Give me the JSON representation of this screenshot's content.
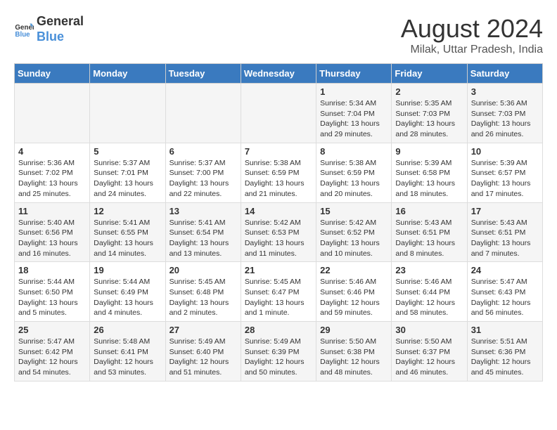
{
  "header": {
    "logo_line1": "General",
    "logo_line2": "Blue",
    "main_title": "August 2024",
    "subtitle": "Milak, Uttar Pradesh, India"
  },
  "days_of_week": [
    "Sunday",
    "Monday",
    "Tuesday",
    "Wednesday",
    "Thursday",
    "Friday",
    "Saturday"
  ],
  "weeks": [
    [
      {
        "day": "",
        "info": ""
      },
      {
        "day": "",
        "info": ""
      },
      {
        "day": "",
        "info": ""
      },
      {
        "day": "",
        "info": ""
      },
      {
        "day": "1",
        "info": "Sunrise: 5:34 AM\nSunset: 7:04 PM\nDaylight: 13 hours\nand 29 minutes."
      },
      {
        "day": "2",
        "info": "Sunrise: 5:35 AM\nSunset: 7:03 PM\nDaylight: 13 hours\nand 28 minutes."
      },
      {
        "day": "3",
        "info": "Sunrise: 5:36 AM\nSunset: 7:03 PM\nDaylight: 13 hours\nand 26 minutes."
      }
    ],
    [
      {
        "day": "4",
        "info": "Sunrise: 5:36 AM\nSunset: 7:02 PM\nDaylight: 13 hours\nand 25 minutes."
      },
      {
        "day": "5",
        "info": "Sunrise: 5:37 AM\nSunset: 7:01 PM\nDaylight: 13 hours\nand 24 minutes."
      },
      {
        "day": "6",
        "info": "Sunrise: 5:37 AM\nSunset: 7:00 PM\nDaylight: 13 hours\nand 22 minutes."
      },
      {
        "day": "7",
        "info": "Sunrise: 5:38 AM\nSunset: 6:59 PM\nDaylight: 13 hours\nand 21 minutes."
      },
      {
        "day": "8",
        "info": "Sunrise: 5:38 AM\nSunset: 6:59 PM\nDaylight: 13 hours\nand 20 minutes."
      },
      {
        "day": "9",
        "info": "Sunrise: 5:39 AM\nSunset: 6:58 PM\nDaylight: 13 hours\nand 18 minutes."
      },
      {
        "day": "10",
        "info": "Sunrise: 5:39 AM\nSunset: 6:57 PM\nDaylight: 13 hours\nand 17 minutes."
      }
    ],
    [
      {
        "day": "11",
        "info": "Sunrise: 5:40 AM\nSunset: 6:56 PM\nDaylight: 13 hours\nand 16 minutes."
      },
      {
        "day": "12",
        "info": "Sunrise: 5:41 AM\nSunset: 6:55 PM\nDaylight: 13 hours\nand 14 minutes."
      },
      {
        "day": "13",
        "info": "Sunrise: 5:41 AM\nSunset: 6:54 PM\nDaylight: 13 hours\nand 13 minutes."
      },
      {
        "day": "14",
        "info": "Sunrise: 5:42 AM\nSunset: 6:53 PM\nDaylight: 13 hours\nand 11 minutes."
      },
      {
        "day": "15",
        "info": "Sunrise: 5:42 AM\nSunset: 6:52 PM\nDaylight: 13 hours\nand 10 minutes."
      },
      {
        "day": "16",
        "info": "Sunrise: 5:43 AM\nSunset: 6:51 PM\nDaylight: 13 hours\nand 8 minutes."
      },
      {
        "day": "17",
        "info": "Sunrise: 5:43 AM\nSunset: 6:51 PM\nDaylight: 13 hours\nand 7 minutes."
      }
    ],
    [
      {
        "day": "18",
        "info": "Sunrise: 5:44 AM\nSunset: 6:50 PM\nDaylight: 13 hours\nand 5 minutes."
      },
      {
        "day": "19",
        "info": "Sunrise: 5:44 AM\nSunset: 6:49 PM\nDaylight: 13 hours\nand 4 minutes."
      },
      {
        "day": "20",
        "info": "Sunrise: 5:45 AM\nSunset: 6:48 PM\nDaylight: 13 hours\nand 2 minutes."
      },
      {
        "day": "21",
        "info": "Sunrise: 5:45 AM\nSunset: 6:47 PM\nDaylight: 13 hours\nand 1 minute."
      },
      {
        "day": "22",
        "info": "Sunrise: 5:46 AM\nSunset: 6:46 PM\nDaylight: 12 hours\nand 59 minutes."
      },
      {
        "day": "23",
        "info": "Sunrise: 5:46 AM\nSunset: 6:44 PM\nDaylight: 12 hours\nand 58 minutes."
      },
      {
        "day": "24",
        "info": "Sunrise: 5:47 AM\nSunset: 6:43 PM\nDaylight: 12 hours\nand 56 minutes."
      }
    ],
    [
      {
        "day": "25",
        "info": "Sunrise: 5:47 AM\nSunset: 6:42 PM\nDaylight: 12 hours\nand 54 minutes."
      },
      {
        "day": "26",
        "info": "Sunrise: 5:48 AM\nSunset: 6:41 PM\nDaylight: 12 hours\nand 53 minutes."
      },
      {
        "day": "27",
        "info": "Sunrise: 5:49 AM\nSunset: 6:40 PM\nDaylight: 12 hours\nand 51 minutes."
      },
      {
        "day": "28",
        "info": "Sunrise: 5:49 AM\nSunset: 6:39 PM\nDaylight: 12 hours\nand 50 minutes."
      },
      {
        "day": "29",
        "info": "Sunrise: 5:50 AM\nSunset: 6:38 PM\nDaylight: 12 hours\nand 48 minutes."
      },
      {
        "day": "30",
        "info": "Sunrise: 5:50 AM\nSunset: 6:37 PM\nDaylight: 12 hours\nand 46 minutes."
      },
      {
        "day": "31",
        "info": "Sunrise: 5:51 AM\nSunset: 6:36 PM\nDaylight: 12 hours\nand 45 minutes."
      }
    ]
  ]
}
